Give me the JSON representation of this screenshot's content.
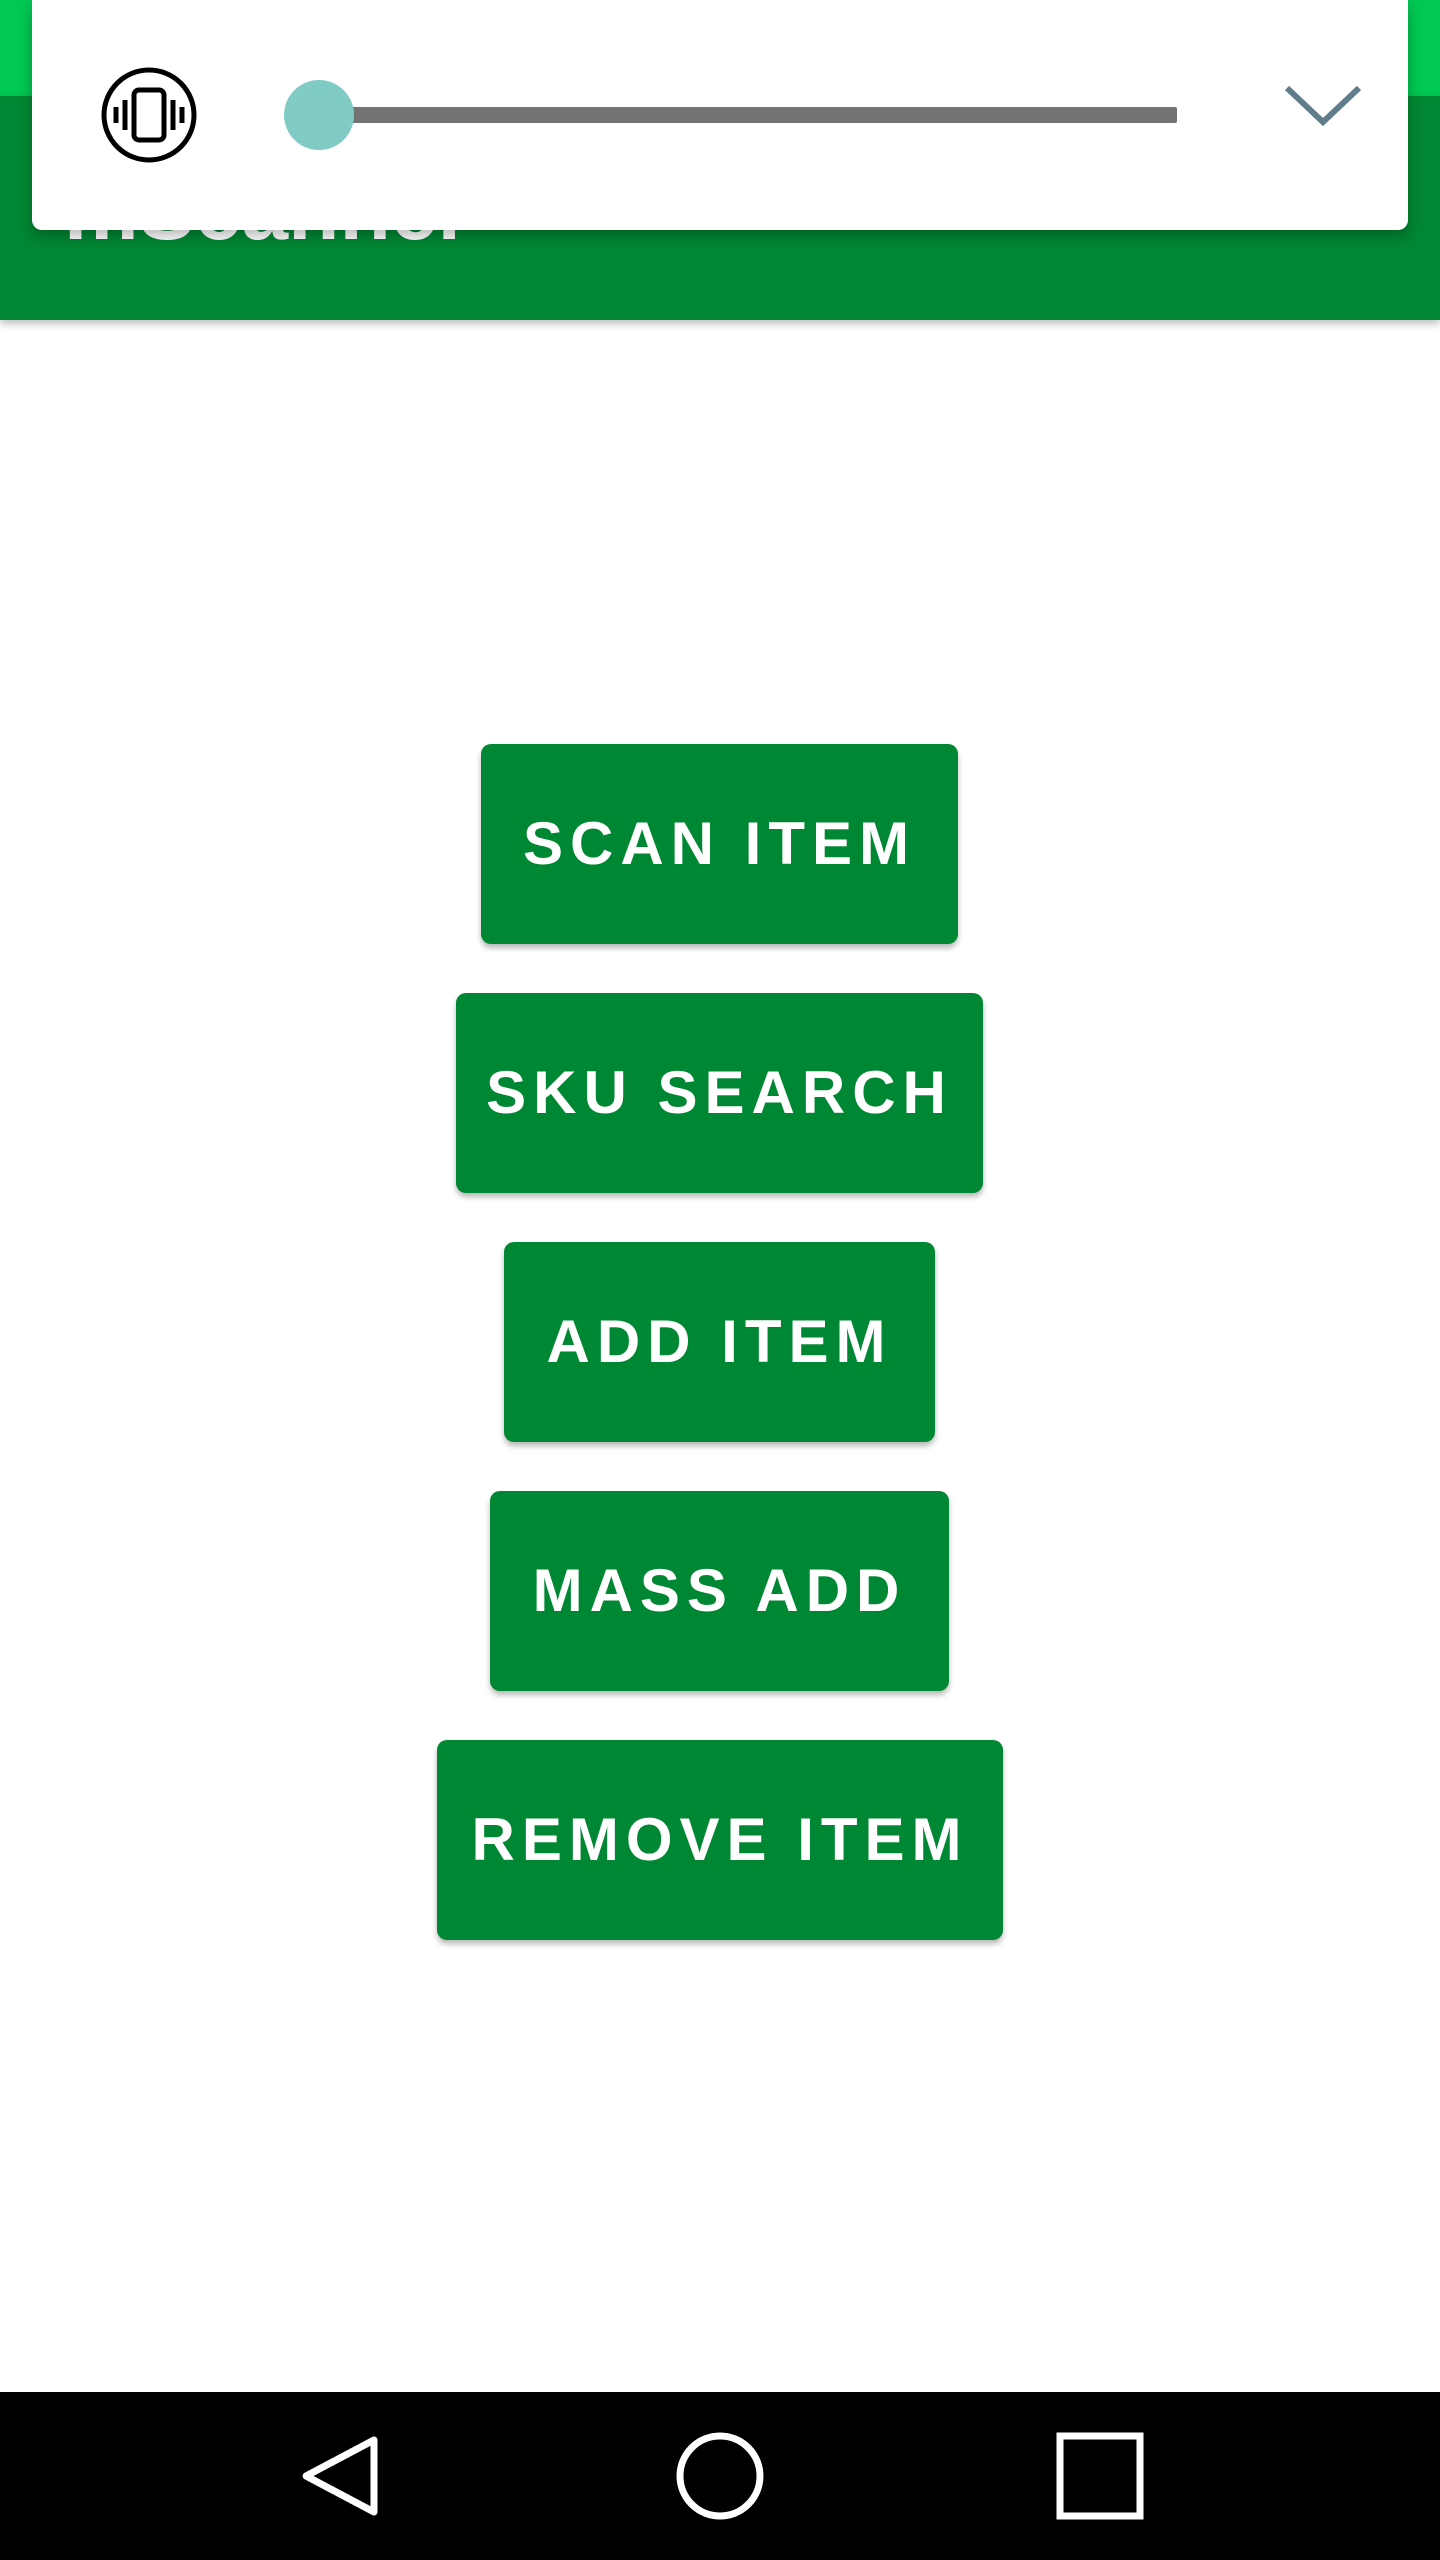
{
  "app": {
    "title": "mScanner"
  },
  "colors": {
    "status_bar": "#00c853",
    "app_bar": "#008733",
    "button": "#008733",
    "button_text": "#ffffff",
    "slider_thumb": "#80cbc4",
    "slider_track": "#737373",
    "nav_bar": "#000000"
  },
  "volume_panel": {
    "mode_icon": "vibrate-icon",
    "level": 0,
    "collapse_icon": "chevron-down-icon"
  },
  "actions": [
    {
      "label": "SCAN ITEM"
    },
    {
      "label": "SKU SEARCH"
    },
    {
      "label": "ADD ITEM"
    },
    {
      "label": "MASS ADD"
    },
    {
      "label": "REMOVE ITEM"
    }
  ],
  "navigation": {
    "icons": [
      "back-icon",
      "home-icon",
      "recents-icon"
    ]
  }
}
